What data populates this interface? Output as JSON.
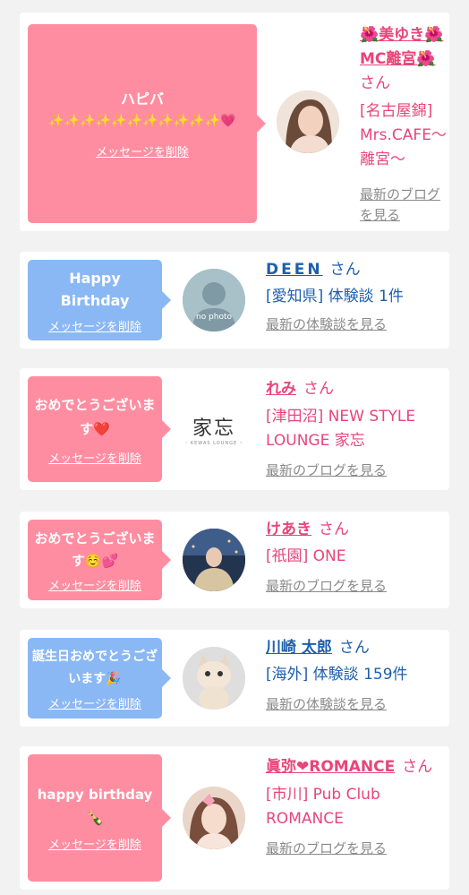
{
  "cards": [
    {
      "message": "ハピバ",
      "message_extra": "✨✨✨✨✨✨✨✨✨✨✨💗",
      "delete_label": "メッセージを削除",
      "name": "🌺美ゆき🌺MC離宮🌺",
      "san": "さん",
      "shop": "[名古屋錦] Mrs.CAFE～離宮～",
      "link": "最新のブログを見る",
      "avatar_icon": "profile-photo-woman"
    },
    {
      "message": "Happy Birthday",
      "delete_label": "メッセージを削除",
      "name": "DEEN",
      "san": "さん",
      "shop": "[愛知県] 体験談 1件",
      "link": "最新の体験談を見る",
      "avatar_icon": "no-photo",
      "avatar_text": "no photo"
    },
    {
      "message": "おめでとうございます❤️",
      "delete_label": "メッセージを削除",
      "name": "れみ",
      "san": "さん",
      "shop": "[津田沼] NEW STYLE LOUNGE 家忘",
      "link": "最新のブログを見る",
      "avatar_icon": "shop-logo",
      "logo_text": "家忘",
      "logo_sub": "~ KEWAS LOUNGE ~"
    },
    {
      "message": "おめでとうございます☺️💕",
      "delete_label": "メッセージを削除",
      "name": "けあき",
      "san": "さん",
      "shop": "[祇園] ONE",
      "link": "最新のブログを見る",
      "avatar_icon": "profile-photo-night"
    },
    {
      "message": "誕生日おめでとうございます🎉",
      "delete_label": "メッセージを削除",
      "name": "川崎 太郎",
      "san": "さん",
      "shop": "[海外] 体験談 159件",
      "link": "最新の体験談を見る",
      "avatar_icon": "kitten-photo"
    },
    {
      "message": "happy birthday",
      "message_extra": "🍾",
      "delete_label": "メッセージを削除",
      "name": "眞弥❤ROMANCE",
      "san": "さん",
      "shop": "[市川] Pub Club ROMANCE",
      "link": "最新のブログを見る",
      "avatar_icon": "profile-photo-woman-2"
    }
  ],
  "colors": {
    "pink_bubble": "#ff8da1",
    "blue_bubble": "#8ab8f5",
    "pink_text": "#e8457a",
    "blue_text": "#1d5fae"
  }
}
